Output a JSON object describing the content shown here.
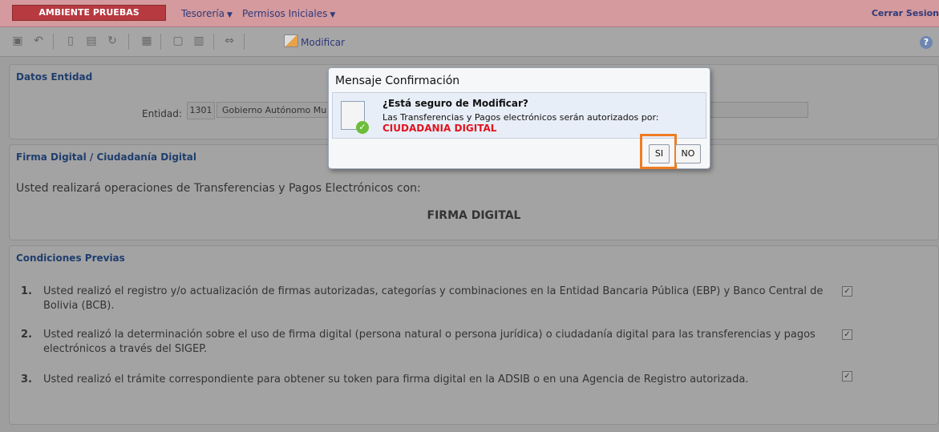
{
  "topbar": {
    "env": "AMBIENTE PRUEBAS",
    "menus": [
      "Tesorería",
      "Permisos Iniciales"
    ],
    "logout": "Cerrar Sesion",
    "caret": "▼"
  },
  "toolbar": {
    "modify": "Modificar",
    "help": "?"
  },
  "entidad": {
    "title": "Datos Entidad",
    "label": "Entidad:",
    "code": "1301",
    "name": "Gobierno Autónomo Mu"
  },
  "firma": {
    "title": "Firma Digital / Ciudadanía Digital",
    "text": "Usted realizará operaciones de Transferencias y Pagos Electrónicos con:",
    "mode": "FIRMA DIGITAL"
  },
  "condiciones": {
    "title": "Condiciones Previas",
    "items": [
      {
        "num": "1.",
        "text": "Usted realizó el registro y/o actualización de firmas autorizadas, categorías y combinaciones en la Entidad Bancaria Pública (EBP) y Banco Central de Bolivia (BCB).",
        "checked": true
      },
      {
        "num": "2.",
        "text": "Usted realizó la determinación sobre el uso de firma digital (persona natural o persona jurídica) o ciudadanía digital para las transferencias y pagos electrónicos a través del SIGEP.",
        "checked": true
      },
      {
        "num": "3.",
        "text": "Usted realizó el trámite correspondiente para obtener su token para firma digital en la ADSIB o en una Agencia de Registro autorizada.",
        "checked": true
      }
    ]
  },
  "dialog": {
    "title": "Mensaje Confirmación",
    "question": "¿Está seguro de Modificar?",
    "info": "Las Transferencias y Pagos electrónicos serán autorizados por:",
    "highlight": "CIUDADANIA DIGITAL",
    "yes": "SI",
    "no": "NO"
  },
  "colors": {
    "topbar": "#d49a9e",
    "badge": "#b73a40",
    "highlight": "#e0141e",
    "focus": "#ee7d22"
  }
}
